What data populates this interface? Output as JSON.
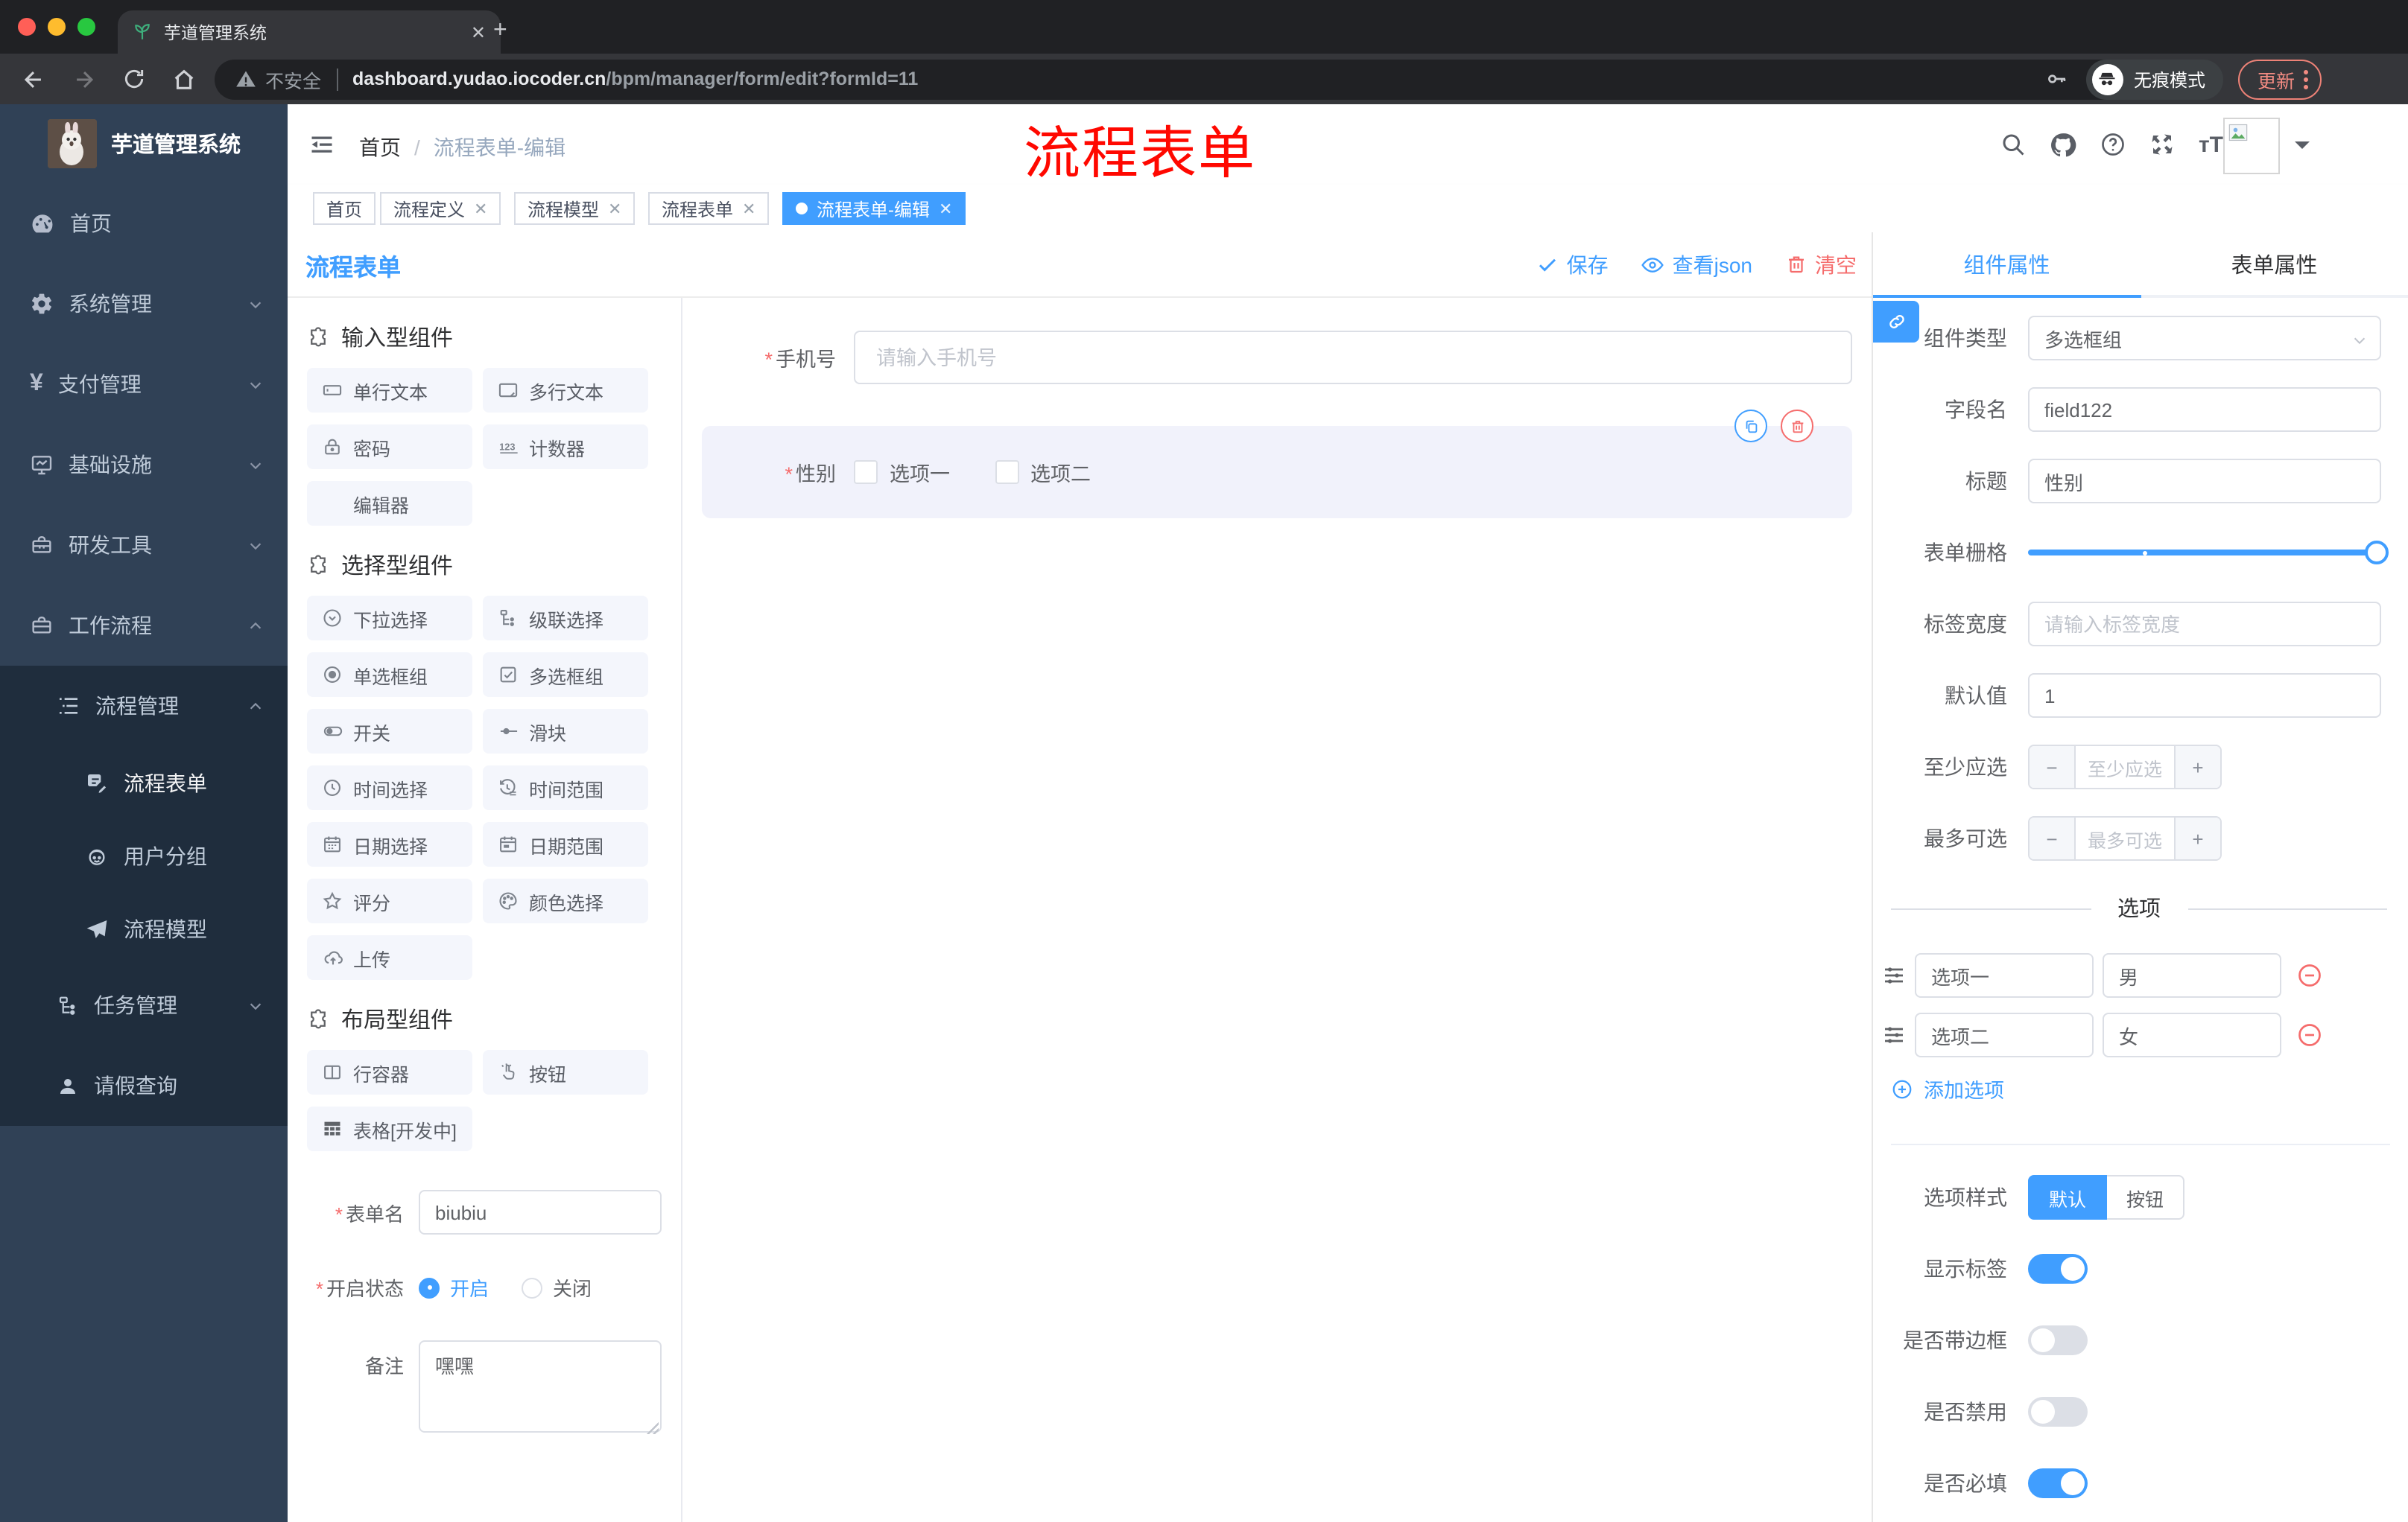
{
  "colors": {
    "primary": "#409EFF",
    "danger": "#F56C6C",
    "sidebar_bg": "#304156",
    "submenu_bg": "#1f2d3d"
  },
  "browser": {
    "tab_title": "芋道管理系统",
    "security_label": "不安全",
    "url_host": "dashboard.yudao.iocoder.cn",
    "url_path": "/bpm/manager/form/edit?formId=11",
    "incognito_label": "无痕模式",
    "update_label": "更新"
  },
  "sidebar": {
    "logo_title": "芋道管理系统",
    "menu": [
      {
        "label": "首页"
      },
      {
        "label": "系统管理"
      },
      {
        "label": "支付管理"
      },
      {
        "label": "基础设施"
      },
      {
        "label": "研发工具"
      },
      {
        "label": "工作流程"
      }
    ],
    "process_mgmt": "流程管理",
    "process_children": [
      "流程表单",
      "用户分组",
      "流程模型"
    ],
    "task_mgmt": "任务管理",
    "leave_query": "请假查询"
  },
  "header": {
    "breadcrumb_home": "首页",
    "breadcrumb_sep": "/",
    "breadcrumb_current": "流程表单-编辑",
    "annotation": "流程表单"
  },
  "tags": [
    {
      "label": "首页"
    },
    {
      "label": "流程定义"
    },
    {
      "label": "流程模型"
    },
    {
      "label": "流程表单"
    },
    {
      "label": "流程表单-编辑"
    }
  ],
  "editor": {
    "title": "流程表单",
    "save": "保存",
    "view_json": "查看json",
    "clear": "清空"
  },
  "palette": {
    "sections": [
      {
        "title": "输入型组件",
        "items": [
          "单行文本",
          "多行文本",
          "密码",
          "计数器",
          "编辑器"
        ]
      },
      {
        "title": "选择型组件",
        "items": [
          "下拉选择",
          "级联选择",
          "单选框组",
          "多选框组",
          "开关",
          "滑块",
          "时间选择",
          "时间范围",
          "日期选择",
          "日期范围",
          "评分",
          "颜色选择",
          "上传"
        ]
      },
      {
        "title": "布局型组件",
        "items": [
          "行容器",
          "按钮",
          "表格[开发中]"
        ]
      }
    ]
  },
  "meta": {
    "name_label": "表单名",
    "name_value": "biubiu",
    "status_label": "开启状态",
    "status_on": "开启",
    "status_off": "关闭",
    "remark_label": "备注",
    "remark_value": "嘿嘿"
  },
  "canvas": {
    "phone_label": "手机号",
    "phone_placeholder": "请输入手机号",
    "gender_label": "性别",
    "gender_options": [
      "选项一",
      "选项二"
    ]
  },
  "props": {
    "tabs": {
      "component": "组件属性",
      "form": "表单属性"
    },
    "type_label": "组件类型",
    "type_value": "多选框组",
    "field_label": "字段名",
    "field_value": "field122",
    "title_label": "标题",
    "title_value": "性别",
    "grid_label": "表单栅格",
    "label_width_label": "标签宽度",
    "label_width_placeholder": "请输入标签宽度",
    "default_label": "默认值",
    "default_value": "1",
    "min_label": "至少应选",
    "min_placeholder": "至少应选",
    "max_label": "最多可选",
    "max_placeholder": "最多可选",
    "stepper_minus": "−",
    "stepper_plus": "+",
    "options_divider": "选项",
    "options": [
      {
        "label": "选项一",
        "value": "男"
      },
      {
        "label": "选项二",
        "value": "女"
      }
    ],
    "add_option": "添加选项",
    "style_label": "选项样式",
    "style_default": "默认",
    "style_button": "按钮",
    "toggles": [
      {
        "label": "显示标签"
      },
      {
        "label": "是否带边框"
      },
      {
        "label": "是否禁用"
      },
      {
        "label": "是否必填"
      }
    ]
  }
}
